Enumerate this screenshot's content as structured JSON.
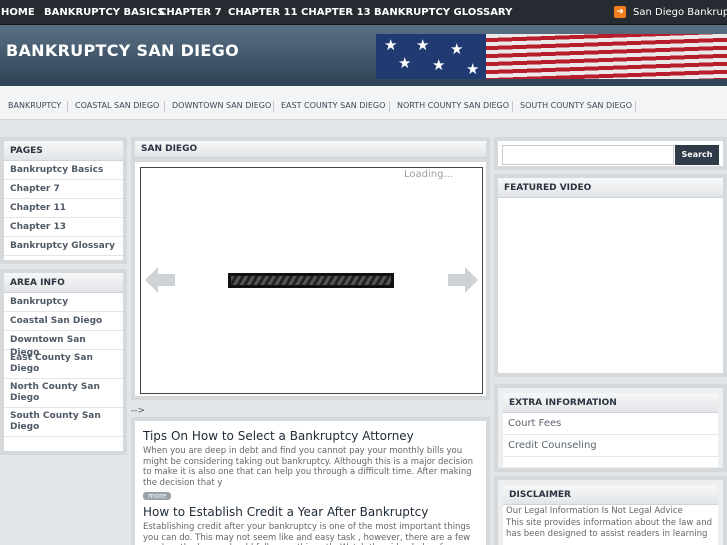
{
  "topnav": {
    "items": [
      "HOME",
      "BANKRUPTCY BASICS",
      "CHAPTER 7",
      "CHAPTER 11",
      "CHAPTER 13",
      "BANKRUPTCY GLOSSARY"
    ],
    "site_link": "San Diego Bankruptcy"
  },
  "header": {
    "title": "BANKRUPTCY SAN DIEGO"
  },
  "subnav": {
    "items": [
      "BANKRUPTCY",
      "COASTAL SAN DIEGO",
      "DOWNTOWN SAN DIEGO",
      "EAST COUNTY SAN DIEGO",
      "NORTH COUNTY SAN DIEGO",
      "SOUTH COUNTY SAN DIEGO"
    ]
  },
  "sidebar": {
    "pages_heading": "PAGES",
    "pages": [
      "Bankruptcy Basics",
      "Chapter 7",
      "Chapter 11",
      "Chapter 13",
      "Bankruptcy Glossary"
    ],
    "area_heading": "AREA INFO",
    "areas": [
      "Bankruptcy",
      "Coastal San Diego",
      "Downtown San Diego",
      "East County San Diego",
      "North County San Diego",
      "South County San Diego"
    ]
  },
  "main": {
    "heading": "SAN DIEGO",
    "loading_text": "Loading...",
    "stray_text": "-->",
    "posts": [
      {
        "title": "Tips On How to Select a Bankruptcy Attorney",
        "excerpt": "When you are deep in debt and find you cannot pay your monthly bills you might be considering taking out bankruptcy. Although this is a major decision to make it is also one that can help you through a difficult time. After making the decision that y",
        "more": "more"
      },
      {
        "title": "How to Establish Credit a Year After Bankruptcy",
        "excerpt": "Establishing credit after your bankruptcy is one of the most important things you can do. This may not seem like and easy task , however, there are a few good methods you should follow on this path. Watch the video below for some"
      }
    ]
  },
  "right": {
    "search_placeholder": "",
    "search_button": "Search",
    "featured_video_heading": "FEATURED VIDEO",
    "extra_heading": "EXTRA INFORMATION",
    "extra_links": [
      "Court Fees",
      "Credit Counseling"
    ],
    "disclaimer_heading": "DISCLAIMER",
    "disclaimer_lines": [
      "Our Legal Information Is Not Legal Advice",
      "This site provides information about the law and has been designed to assist readers in learning"
    ]
  },
  "colors": {
    "topnav_bg": "#262b31",
    "header_bg": "#2e4255",
    "rss": "#f47d19",
    "search_button": "#2f3b48"
  }
}
